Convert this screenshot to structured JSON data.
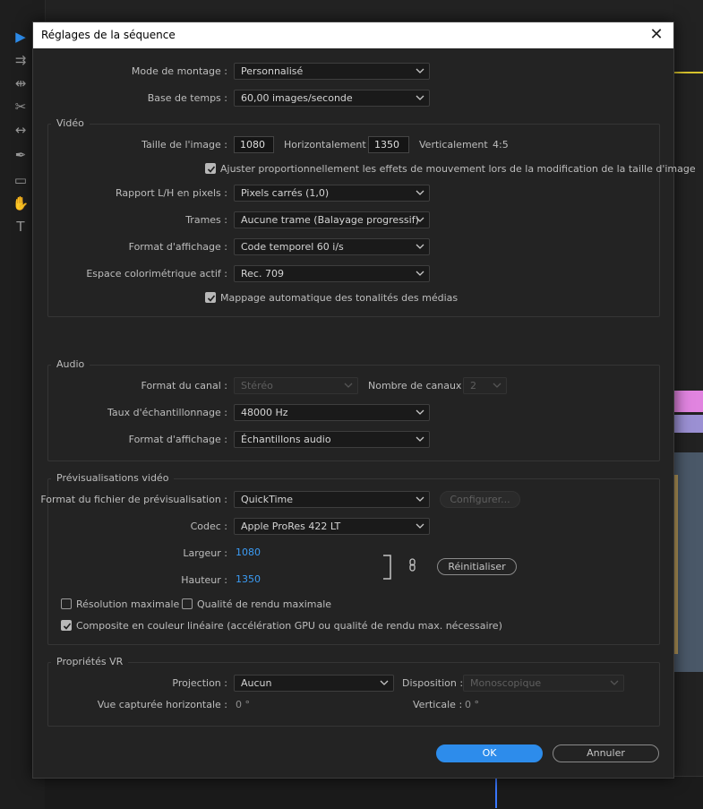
{
  "dialog": {
    "title": "Réglages de la séquence"
  },
  "editing_mode": {
    "label": "Mode de montage :",
    "value": "Personnalisé"
  },
  "timebase": {
    "label": "Base de temps :",
    "value": "60,00  images/seconde"
  },
  "video": {
    "title": "Vidéo",
    "frame_size": {
      "label": "Taille de l'image :",
      "width": "1080",
      "h_label": "Horizontalement",
      "height": "1350",
      "v_label": "Verticalement",
      "ratio": "4:5"
    },
    "scale_check": "Ajuster proportionnellement les effets de mouvement lors de la modification de la taille d'image",
    "pixel_aspect": {
      "label": "Rapport L/H en pixels :",
      "value": "Pixels carrés (1,0)"
    },
    "fields": {
      "label": "Trames :",
      "value": "Aucune trame (Balayage progressif)"
    },
    "display_format": {
      "label": "Format d'affichage :",
      "value": "Code temporel 60 i/s"
    },
    "working_color": {
      "label": "Espace colorimétrique actif :",
      "value": "Rec. 709"
    },
    "tone_map_check": "Mappage automatique des tonalités des médias"
  },
  "audio": {
    "title": "Audio",
    "channel_format": {
      "label": "Format du canal :",
      "value": "Stéréo"
    },
    "num_channels": {
      "label": "Nombre de canaux :",
      "value": "2"
    },
    "sample_rate": {
      "label": "Taux d'échantillonnage :",
      "value": "48000 Hz"
    },
    "display_format": {
      "label": "Format d'affichage :",
      "value": "Échantillons audio"
    }
  },
  "previews": {
    "title": "Prévisualisations vidéo",
    "file_format": {
      "label": "Format du fichier de prévisualisation :",
      "value": "QuickTime"
    },
    "configure": "Configurer...",
    "codec": {
      "label": "Codec :",
      "value": "Apple ProRes 422 LT"
    },
    "width": {
      "label": "Largeur :",
      "value": "1080"
    },
    "height": {
      "label": "Hauteur :",
      "value": "1350"
    },
    "reset": "Réinitialiser",
    "max_bit_depth": "Résolution maximale",
    "max_render_quality": "Qualité de rendu maximale",
    "linear_color": "Composite en couleur linéaire (accélération GPU ou qualité de rendu max. nécessaire)"
  },
  "vr": {
    "title": "Propriétés VR",
    "projection": {
      "label": "Projection :",
      "value": "Aucun"
    },
    "layout": {
      "label": "Disposition :",
      "value": "Monoscopique"
    },
    "h_fov": {
      "label": "Vue capturée horizontale :",
      "value": "0 °"
    },
    "v_fov": {
      "label": "Verticale :",
      "value": "0 °"
    }
  },
  "buttons": {
    "ok": "OK",
    "cancel": "Annuler"
  },
  "colors": {
    "accent": "#2d8ceb",
    "value_blue": "#3b9cf5",
    "dialog_bg": "#232323"
  }
}
